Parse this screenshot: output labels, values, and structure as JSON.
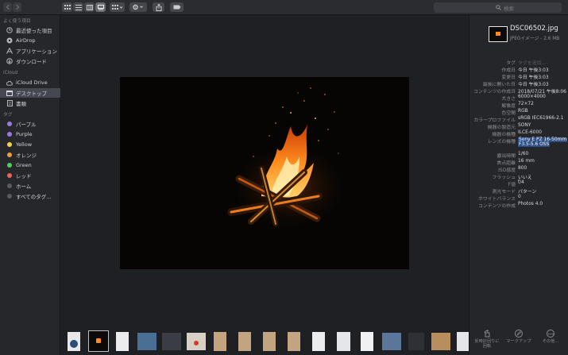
{
  "toolbar": {
    "search_placeholder": "検索"
  },
  "sidebar": {
    "favorites_header": "よく使う項目",
    "favorites": [
      {
        "label": "最近使った項目",
        "icon": "clock-icon"
      },
      {
        "label": "AirDrop",
        "icon": "airdrop-icon"
      },
      {
        "label": "アプリケーション",
        "icon": "applications-icon"
      },
      {
        "label": "ダウンロード",
        "icon": "download-icon"
      }
    ],
    "icloud_header": "iCloud",
    "icloud": [
      {
        "label": "iCloud Drive",
        "icon": "cloud-icon"
      },
      {
        "label": "デスクトップ",
        "icon": "desktop-icon",
        "selected": true
      },
      {
        "label": "書類",
        "icon": "document-icon"
      }
    ],
    "tags_header": "タグ",
    "tags": [
      {
        "label": "パープル",
        "color": "#9b7be0"
      },
      {
        "label": "Purple",
        "color": "#9b7be0"
      },
      {
        "label": "Yellow",
        "color": "#f1d44a"
      },
      {
        "label": "オレンジ",
        "color": "#f29b3c"
      },
      {
        "label": "Green",
        "color": "#4fcf5f"
      },
      {
        "label": "レッド",
        "color": "#f0625a"
      },
      {
        "label": "ホーム",
        "color": "#5a5b60"
      },
      {
        "label": "すべてのタグ...",
        "color": "#5a5b60"
      }
    ]
  },
  "inspector": {
    "filename": "DSC06502.jpg",
    "subtitle": "JPEGイメージ - 2.6 MB",
    "rows": [
      {
        "label": "タグ",
        "value": "タグを追加...",
        "placeholder": true
      },
      {
        "label": "作成日",
        "value": "今日 午後3:03"
      },
      {
        "label": "変更日",
        "value": "今日 午後3:03"
      },
      {
        "label": "最後に開いた日",
        "value": "今日 午後3:03"
      },
      {
        "label": "コンテンツの作成日",
        "value": "2018/07/21 午後8:06"
      },
      {
        "label": "大きさ",
        "value": "6000×4000"
      },
      {
        "label": "解像度",
        "value": "72×72"
      },
      {
        "label": "色空間",
        "value": "RGB"
      },
      {
        "label": "カラープロファイル",
        "value": "sRGB IEC61966-2.1"
      },
      {
        "label": "機器の製造元",
        "value": "SONY"
      },
      {
        "label": "機器の機種",
        "value": "ILCE-6000"
      },
      {
        "label": "レンズの機種",
        "value": "Sony E PZ 16-50mm",
        "value2": "F3.5-5.6 OSS",
        "highlight": true
      },
      {
        "label": "露出時間",
        "value": "1/60"
      },
      {
        "label": "焦点距離",
        "value": "16 mm"
      },
      {
        "label": "ISO感度",
        "value": "800"
      },
      {
        "label": "フラッシュ",
        "value": "いいえ"
      },
      {
        "label": "F値",
        "value": "f/4"
      },
      {
        "label": "測光モード",
        "value": "パターン"
      },
      {
        "label": "ホワイトバランス",
        "value": "0"
      },
      {
        "label": "コンテンツの作成",
        "value": "Photos 4.0"
      }
    ],
    "actions": [
      {
        "label": "反時計回りに",
        "label2": "回転",
        "icon": "rotate-left-icon"
      },
      {
        "label": "マークアップ",
        "icon": "markup-icon"
      },
      {
        "label": "その他...",
        "icon": "more-icon"
      }
    ]
  },
  "colors": {
    "accent": "#2b4f86",
    "selection": "#464851"
  }
}
